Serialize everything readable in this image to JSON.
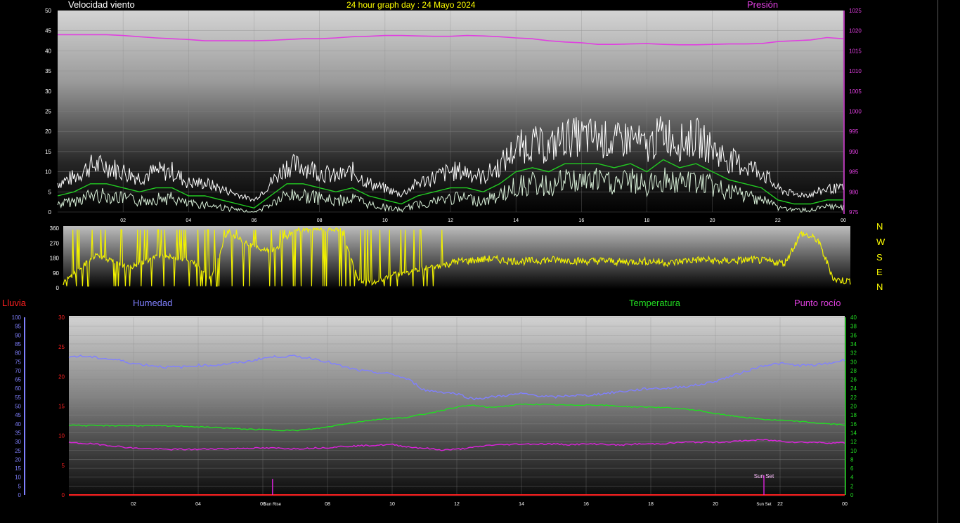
{
  "header": {
    "wind_title": "Velocidad viento",
    "graph_title": "24 hour graph day : 24 Mayo 2024",
    "pressure_title": "Presión"
  },
  "labels": {
    "rain": "Lluvia",
    "humidity": "Humedad",
    "temperature": "Temperatura",
    "dewpoint": "Punto rocío",
    "sunrise": "Sun Rise",
    "sunset": "Sun Set"
  },
  "compass": [
    "N",
    "W",
    "S",
    "E",
    "N"
  ],
  "colors": {
    "wind_gust": "#ffffff",
    "wind_speed": "#d8f0d8",
    "wind_avg": "#22cc22",
    "pressure": "#e040e0",
    "direction": "#f2f200",
    "humidity": "#8080ff",
    "temperature": "#22dd22",
    "dewpoint": "#dd22dd",
    "rain": "#ff2020",
    "title_yellow": "#ffff00"
  },
  "x_ticks": [
    "02",
    "04",
    "06",
    "08",
    "10",
    "12",
    "14",
    "16",
    "18",
    "20",
    "22",
    "00"
  ],
  "chart_data": [
    {
      "type": "line",
      "name": "wind",
      "xlim": [
        0,
        24
      ],
      "ylim": [
        0,
        50
      ],
      "y_ticks": [
        0,
        5,
        10,
        15,
        20,
        25,
        30,
        35,
        40,
        45,
        50
      ],
      "y2lim": [
        975,
        1025
      ],
      "y2_ticks": [
        975,
        980,
        985,
        990,
        995,
        1000,
        1005,
        1010,
        1015,
        1020,
        1025
      ],
      "grid": true,
      "series": [
        {
          "name": "Velocidad viento",
          "axis": "y",
          "color": "#22cc22",
          "x": [
            0,
            0.5,
            1,
            1.5,
            2,
            2.5,
            3,
            3.5,
            4,
            4.5,
            5,
            5.5,
            6,
            6.5,
            7,
            7.5,
            8,
            8.5,
            9,
            9.5,
            10,
            10.5,
            11,
            11.5,
            12,
            12.5,
            13,
            13.5,
            14,
            14.5,
            15,
            15.5,
            16,
            16.5,
            17,
            17.5,
            18,
            18.5,
            19,
            19.5,
            20,
            20.5,
            21,
            21.5,
            22,
            22.5,
            23,
            23.5,
            24
          ],
          "values": [
            4,
            5,
            7,
            7,
            6,
            5,
            6,
            6,
            4,
            4,
            3,
            2,
            1,
            4,
            7,
            7,
            6,
            5,
            6,
            4,
            3,
            2,
            4,
            5,
            6,
            6,
            5,
            7,
            10,
            11,
            10,
            12,
            12,
            12,
            11,
            12,
            10,
            13,
            11,
            12,
            10,
            8,
            7,
            6,
            3,
            2,
            2,
            3,
            3
          ]
        },
        {
          "name": "Presión",
          "axis": "y2",
          "color": "#e040e0",
          "x": [
            0,
            0.5,
            1,
            1.5,
            2,
            2.5,
            3,
            3.5,
            4,
            4.5,
            5,
            5.5,
            6,
            6.5,
            7,
            7.5,
            8,
            8.5,
            9,
            9.5,
            10,
            10.5,
            11,
            11.5,
            12,
            12.5,
            13,
            13.5,
            14,
            14.5,
            15,
            15.5,
            16,
            16.5,
            17,
            17.5,
            18,
            18.5,
            19,
            19.5,
            20,
            20.5,
            21,
            21.5,
            22,
            22.5,
            23,
            23.5,
            24
          ],
          "values": [
            1019,
            1019,
            1019,
            1019,
            1018.8,
            1018.5,
            1018.2,
            1018,
            1017.8,
            1017.5,
            1017.5,
            1017.5,
            1017.5,
            1017.6,
            1017.8,
            1018,
            1018,
            1018.2,
            1018.5,
            1018.6,
            1018.8,
            1018.8,
            1018.7,
            1018.6,
            1018.6,
            1018.8,
            1018.7,
            1018.5,
            1018.2,
            1018,
            1017.5,
            1017.2,
            1017,
            1016.6,
            1016.6,
            1016.7,
            1016.8,
            1016.6,
            1016.5,
            1016.5,
            1016.6,
            1016.7,
            1016.7,
            1016.8,
            1017.3,
            1017.5,
            1017.7,
            1018.3,
            1018
          ]
        }
      ]
    },
    {
      "type": "line",
      "name": "wind_direction",
      "xlim": [
        0,
        24
      ],
      "ylim": [
        0,
        360
      ],
      "y_ticks": [
        0,
        90,
        180,
        270,
        360
      ],
      "grid": false,
      "series": [
        {
          "name": "direction",
          "color": "#f2f200",
          "x": [
            0,
            1,
            2,
            3,
            4,
            4.5,
            5,
            5.5,
            6,
            6.5,
            7,
            7.5,
            8,
            8.5,
            9,
            9.5,
            10,
            10.5,
            11,
            11.5,
            12,
            12.5,
            13,
            13.5,
            14,
            14.5,
            15,
            15.5,
            16,
            16.5,
            17,
            17.5,
            18,
            18.5,
            19,
            19.5,
            20,
            20.5,
            21,
            21.5,
            22,
            22.5,
            23,
            23.5,
            24
          ],
          "values": [
            30,
            200,
            120,
            200,
            150,
            60,
            340,
            280,
            230,
            230,
            350,
            350,
            350,
            350,
            40,
            30,
            80,
            90,
            120,
            130,
            160,
            165,
            175,
            165,
            160,
            165,
            170,
            165,
            160,
            165,
            155,
            160,
            160,
            150,
            165,
            170,
            160,
            165,
            170,
            160,
            150,
            330,
            290,
            50,
            40
          ]
        }
      ]
    },
    {
      "type": "line",
      "name": "temperature_humidity",
      "xlim": [
        0,
        24
      ],
      "ylim": [
        0,
        30
      ],
      "y_ticks": [
        0,
        5,
        10,
        15,
        20,
        25,
        30
      ],
      "y_hum_lim": [
        0,
        100
      ],
      "y_hum_ticks": [
        0,
        5,
        10,
        15,
        20,
        25,
        30,
        35,
        40,
        45,
        50,
        55,
        60,
        65,
        70,
        75,
        80,
        85,
        90,
        95,
        100
      ],
      "y2lim": [
        0,
        40
      ],
      "y2_ticks": [
        0,
        2,
        4,
        6,
        8,
        10,
        12,
        14,
        16,
        18,
        20,
        22,
        24,
        26,
        28,
        30,
        32,
        34,
        36,
        38,
        40
      ],
      "grid": true,
      "sunrise_hour": 6.3,
      "sunset_hour": 21.5,
      "series": [
        {
          "name": "Humedad",
          "axis": "hum",
          "color": "#8080ff",
          "x": [
            0,
            0.5,
            1,
            1.5,
            2,
            2.5,
            3,
            3.5,
            4,
            4.5,
            5,
            5.5,
            6,
            6.5,
            7,
            7.5,
            8,
            8.5,
            9,
            9.5,
            10,
            10.5,
            11,
            11.5,
            12,
            12.5,
            13,
            13.5,
            14,
            14.5,
            15,
            15.5,
            16,
            16.5,
            17,
            17.5,
            18,
            18.5,
            19,
            19.5,
            20,
            20.5,
            21,
            21.5,
            22,
            22.5,
            23,
            23.5,
            24
          ],
          "values": [
            78,
            78,
            77,
            76,
            74,
            73,
            72,
            72,
            73,
            73,
            74,
            75,
            77,
            78,
            78,
            77,
            75,
            72,
            70,
            69,
            68,
            65,
            59,
            58,
            57,
            54,
            55,
            56,
            57,
            56,
            55,
            56,
            56,
            57,
            58,
            59,
            60,
            60,
            61,
            62,
            64,
            67,
            70,
            73,
            74,
            73,
            73,
            74,
            76
          ]
        },
        {
          "name": "Temperatura",
          "axis": "y2",
          "color": "#22dd22",
          "x": [
            0,
            0.5,
            1,
            1.5,
            2,
            2.5,
            3,
            3.5,
            4,
            4.5,
            5,
            5.5,
            6,
            6.5,
            7,
            7.5,
            8,
            8.5,
            9,
            9.5,
            10,
            10.5,
            11,
            11.5,
            12,
            12.5,
            13,
            13.5,
            14,
            14.5,
            15,
            15.5,
            16,
            16.5,
            17,
            17.5,
            18,
            18.5,
            19,
            19.5,
            20,
            20.5,
            21,
            21.5,
            22,
            22.5,
            23,
            23.5,
            24
          ],
          "values": [
            15.8,
            15.6,
            15.6,
            15.6,
            15.6,
            15.6,
            15.5,
            15.5,
            15.3,
            15.2,
            15.0,
            14.8,
            14.7,
            14.6,
            14.5,
            14.8,
            15.3,
            16.0,
            16.5,
            17.0,
            17.2,
            17.5,
            18.2,
            19.0,
            19.8,
            20.2,
            19.7,
            20.0,
            20.4,
            20.4,
            20.3,
            20.2,
            20.3,
            20.2,
            20.0,
            19.8,
            19.8,
            19.6,
            19.4,
            19.0,
            18.3,
            17.8,
            17.4,
            17.0,
            16.8,
            16.6,
            16.3,
            16.0,
            15.8
          ]
        },
        {
          "name": "Punto rocío",
          "axis": "y",
          "color": "#dd22dd",
          "x": [
            0,
            0.5,
            1,
            1.5,
            2,
            2.5,
            3,
            3.5,
            4,
            4.5,
            5,
            5.5,
            6,
            6.5,
            7,
            7.5,
            8,
            8.5,
            9,
            9.5,
            10,
            10.5,
            11,
            11.5,
            12,
            12.5,
            13,
            13.5,
            14,
            14.5,
            15,
            15.5,
            16,
            16.5,
            17,
            17.5,
            18,
            18.5,
            19,
            19.5,
            20,
            20.5,
            21,
            21.5,
            22,
            22.5,
            23,
            23.5,
            24
          ],
          "values": [
            8.8,
            8.7,
            8.5,
            8.2,
            7.9,
            7.8,
            7.7,
            7.7,
            7.7,
            7.8,
            7.8,
            7.9,
            7.9,
            7.9,
            7.8,
            7.9,
            8.0,
            8.2,
            8.3,
            8.4,
            8.5,
            8.1,
            7.9,
            7.6,
            7.7,
            8.0,
            8.4,
            8.5,
            8.6,
            8.6,
            8.6,
            8.5,
            8.6,
            8.6,
            8.4,
            8.6,
            8.6,
            8.7,
            8.9,
            8.9,
            8.9,
            9.0,
            9.2,
            9.3,
            9.1,
            8.9,
            8.9,
            8.8,
            8.8
          ]
        },
        {
          "name": "Lluvia",
          "axis": "y",
          "color": "#ff2020",
          "x": [
            0,
            24
          ],
          "values": [
            0,
            0
          ]
        }
      ]
    }
  ]
}
